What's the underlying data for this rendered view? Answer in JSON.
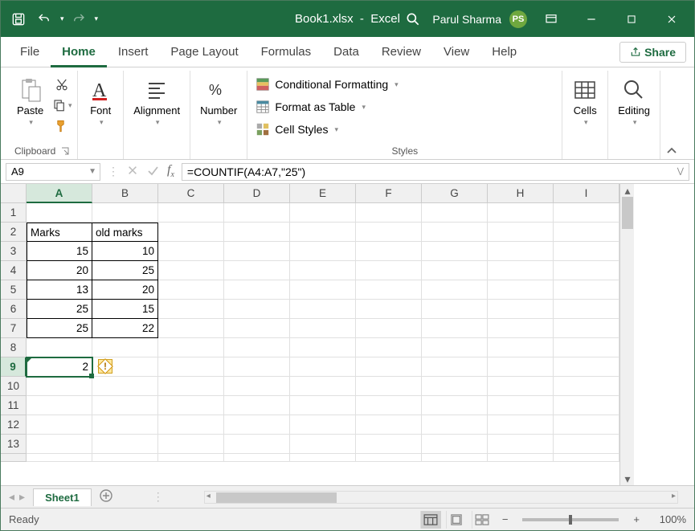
{
  "titlebar": {
    "filename": "Book1.xlsx",
    "app": "Excel",
    "user_name": "Parul Sharma",
    "user_initials": "PS"
  },
  "menus": {
    "file": "File",
    "home": "Home",
    "insert": "Insert",
    "pagelayout": "Page Layout",
    "formulas": "Formulas",
    "data": "Data",
    "review": "Review",
    "view": "View",
    "help": "Help",
    "share": "Share"
  },
  "ribbon": {
    "clipboard": {
      "label": "Clipboard",
      "paste": "Paste"
    },
    "font": {
      "label": "Font"
    },
    "alignment": {
      "label": "Alignment"
    },
    "number": {
      "label": "Number"
    },
    "styles": {
      "label": "Styles",
      "cond_format": "Conditional Formatting",
      "format_table": "Format as Table",
      "cell_styles": "Cell Styles"
    },
    "cells": {
      "label": "Cells"
    },
    "editing": {
      "label": "Editing"
    }
  },
  "formula_bar": {
    "cell_ref": "A9",
    "formula": "=COUNTIF(A4:A7,\"25\")"
  },
  "columns": [
    "A",
    "B",
    "C",
    "D",
    "E",
    "F",
    "G",
    "H",
    "I"
  ],
  "rows_visible": 13,
  "table": {
    "headers": {
      "a": "Marks",
      "b": "old marks"
    },
    "data": [
      {
        "a": 15,
        "b": 10
      },
      {
        "a": 20,
        "b": 25
      },
      {
        "a": 13,
        "b": 20
      },
      {
        "a": 25,
        "b": 15
      },
      {
        "a": 25,
        "b": 22
      }
    ]
  },
  "active_cell_value": "2",
  "sheet_tab": "Sheet1",
  "status": {
    "ready": "Ready",
    "zoom": "100%"
  }
}
